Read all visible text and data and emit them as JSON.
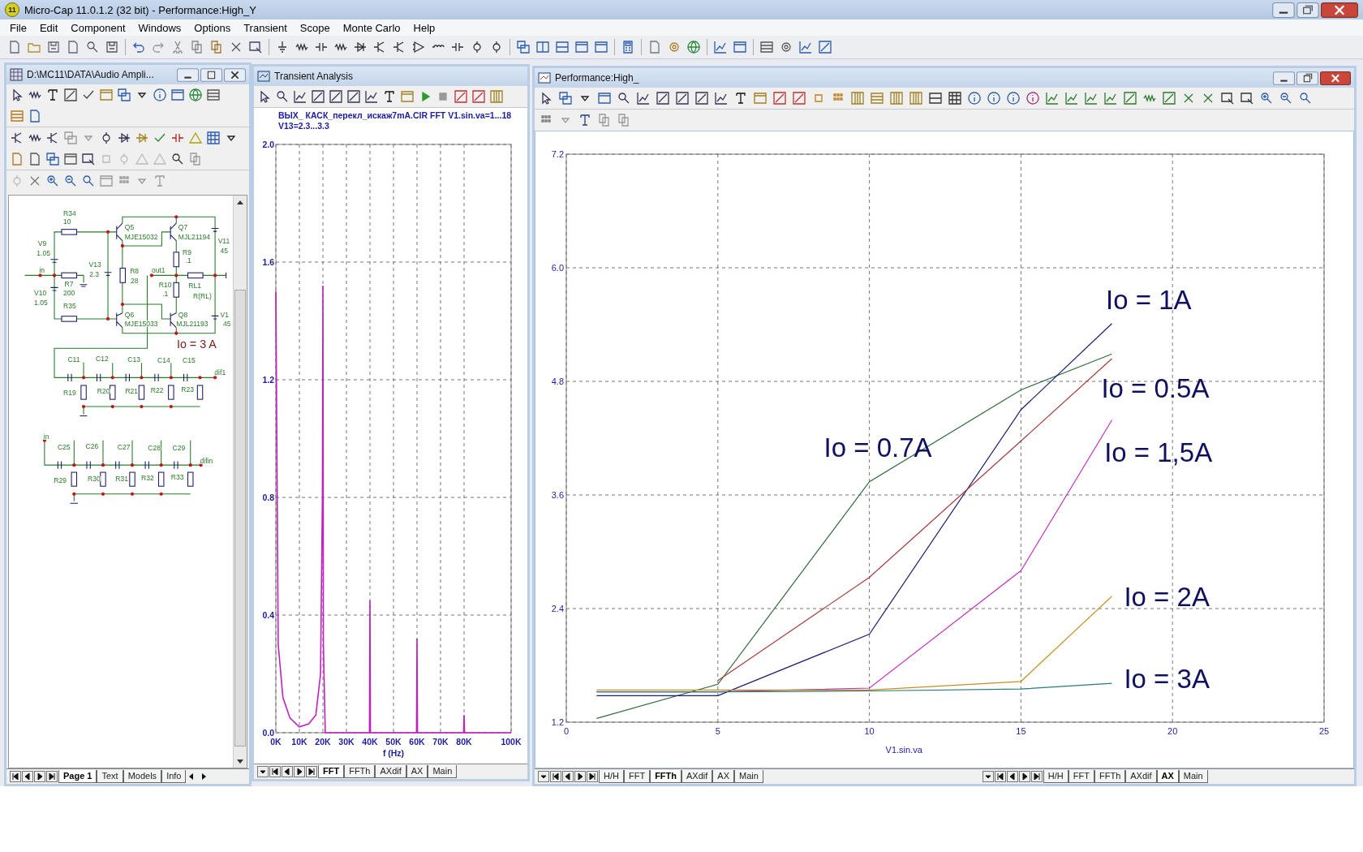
{
  "app": {
    "icon_text": "11",
    "title": "Micro-Cap 11.0.1.2 (32 bit) - Performance:High_Y"
  },
  "menu": [
    "File",
    "Edit",
    "Component",
    "Windows",
    "Options",
    "Transient",
    "Scope",
    "Monte Carlo",
    "Help"
  ],
  "schematic_window": {
    "title": "D:\\MC11\\DATA\\Audio Ampli...",
    "labels": [
      "R34",
      "10",
      "V9",
      "1.05",
      "in",
      "R7",
      "V10",
      "200",
      "1.05",
      "R35",
      "V13",
      "2.3",
      "Q5",
      "MJE15032",
      "R8",
      "28",
      "Q6",
      "MJE15033",
      "Q7",
      "MJL21194",
      "R9",
      ".1",
      "out1",
      "R10",
      ".1",
      "RL1",
      "R(RL)",
      "Q8",
      "MJL21193",
      "V11",
      "45",
      "V1",
      "45",
      "C11",
      "C12",
      "C13",
      "C14",
      "C15",
      "dif1",
      "R19",
      "R20",
      "R21",
      "R22",
      "R23",
      "in",
      "C25",
      "C26",
      "C27",
      "C28",
      "C29",
      "difin",
      "R29",
      "R30",
      "R31",
      "R32",
      "R33"
    ],
    "note": "Io = 3 A",
    "tabs": [
      {
        "label": "Page 1",
        "selected": true
      },
      {
        "label": "Text",
        "selected": false
      },
      {
        "label": "Models",
        "selected": false
      },
      {
        "label": "Info",
        "selected": false
      }
    ]
  },
  "transient_window": {
    "title": "Transient Analysis",
    "caption": [
      "ВЫХ_ КАСК_перекл_искаж7mA.CIR FFT V1.sin.va=1...18",
      "V13=2.3...3.3"
    ],
    "chart_data": {
      "type": "line",
      "grid": true,
      "xlabel": "f (Hz)",
      "xlim": [
        0,
        100000
      ],
      "ylim": [
        0,
        2
      ],
      "xticks": [
        {
          "value": 0,
          "label": "0K"
        },
        {
          "value": 10000,
          "label": "10K"
        },
        {
          "value": 20000,
          "label": "20K"
        },
        {
          "value": 30000,
          "label": "30K"
        },
        {
          "value": 40000,
          "label": "40K"
        },
        {
          "value": 50000,
          "label": "50K"
        },
        {
          "value": 60000,
          "label": "60K"
        },
        {
          "value": 70000,
          "label": "70K"
        },
        {
          "value": 80000,
          "label": "80K"
        },
        {
          "value": 100000,
          "label": "100K"
        }
      ],
      "yticks": [
        {
          "value": 0,
          "label": "0.0"
        },
        {
          "value": 0.4,
          "label": "0.4"
        },
        {
          "value": 0.8,
          "label": "0.8"
        },
        {
          "value": 1.2,
          "label": "1.2"
        },
        {
          "value": 1.6,
          "label": "1.6"
        },
        {
          "value": 2,
          "label": "2.0"
        }
      ],
      "x": [
        0,
        1000,
        3000,
        6000,
        10000,
        14000,
        17000,
        19000,
        19800,
        20000,
        20200,
        21000,
        39800,
        40000,
        40200,
        59800,
        60000,
        60200,
        79800,
        80000,
        80200,
        100000
      ],
      "series": [
        {
          "color": "#c020c0",
          "values": [
            1.5,
            0.3,
            0.12,
            0.05,
            0.02,
            0.03,
            0.06,
            0.2,
            0.8,
            1.52,
            0.3,
            0,
            0,
            0.45,
            0,
            0,
            0.32,
            0,
            0,
            0.06,
            0,
            0
          ]
        }
      ]
    },
    "tabs": [
      {
        "label": "FFT",
        "selected": true
      },
      {
        "label": "FFTh",
        "selected": false
      },
      {
        "label": "AXdif",
        "selected": false
      },
      {
        "label": "AX",
        "selected": false
      },
      {
        "label": "Main",
        "selected": false
      }
    ]
  },
  "performance_window": {
    "title": "Performance:High_",
    "chart_data": {
      "type": "line",
      "grid": true,
      "xlabel": "V1.sin.va",
      "xlim": [
        0,
        25
      ],
      "ylim": [
        1.2,
        7.2
      ],
      "xticks": [
        0,
        5,
        10,
        15,
        20,
        25
      ],
      "yticks": [
        1.2,
        2.4,
        3.6,
        4.8,
        {
          "value": 6,
          "label": "6.0"
        },
        7.2
      ],
      "x": [
        1,
        5,
        10,
        15,
        18
      ],
      "series": [
        {
          "name": "Io = 0.7A",
          "color": "#2e6b3a",
          "values": [
            1.24,
            1.6,
            3.74,
            4.71,
            5.09
          ]
        },
        {
          "name": "Io = 1A",
          "color": "#1c1c70",
          "values": [
            1.48,
            1.48,
            2.13,
            4.5,
            5.41
          ]
        },
        {
          "name": "Io = 0.5A",
          "color": "#a83c3c",
          "values": [
            null,
            1.64,
            2.73,
            4.17,
            5.04
          ]
        },
        {
          "name": "Io = 1,5A",
          "color": "#c030c0",
          "values": [
            1.52,
            1.52,
            1.56,
            2.8,
            4.39
          ]
        },
        {
          "name": "Io = 2A",
          "color": "#c89020",
          "values": [
            1.54,
            1.54,
            1.54,
            1.63,
            2.53
          ]
        },
        {
          "name": "Io = 3A",
          "color": "#2a7a7a",
          "values": [
            1.52,
            1.52,
            1.53,
            1.55,
            1.61
          ]
        }
      ]
    },
    "tabs": [
      {
        "label": "H/H",
        "selected": false
      },
      {
        "label": "FFT",
        "selected": false
      },
      {
        "label": "FFTh",
        "selected": true
      },
      {
        "label": "AXdif",
        "selected": false
      },
      {
        "label": "AX",
        "selected": false
      },
      {
        "label": "Main",
        "selected": false
      }
    ],
    "tabs_2": [
      {
        "label": "H/H",
        "selected": false
      },
      {
        "label": "FFT",
        "selected": false
      },
      {
        "label": "FFTh",
        "selected": false
      },
      {
        "label": "AXdif",
        "selected": false
      },
      {
        "label": "AX",
        "selected": true
      },
      {
        "label": "Main",
        "selected": false
      }
    ]
  }
}
